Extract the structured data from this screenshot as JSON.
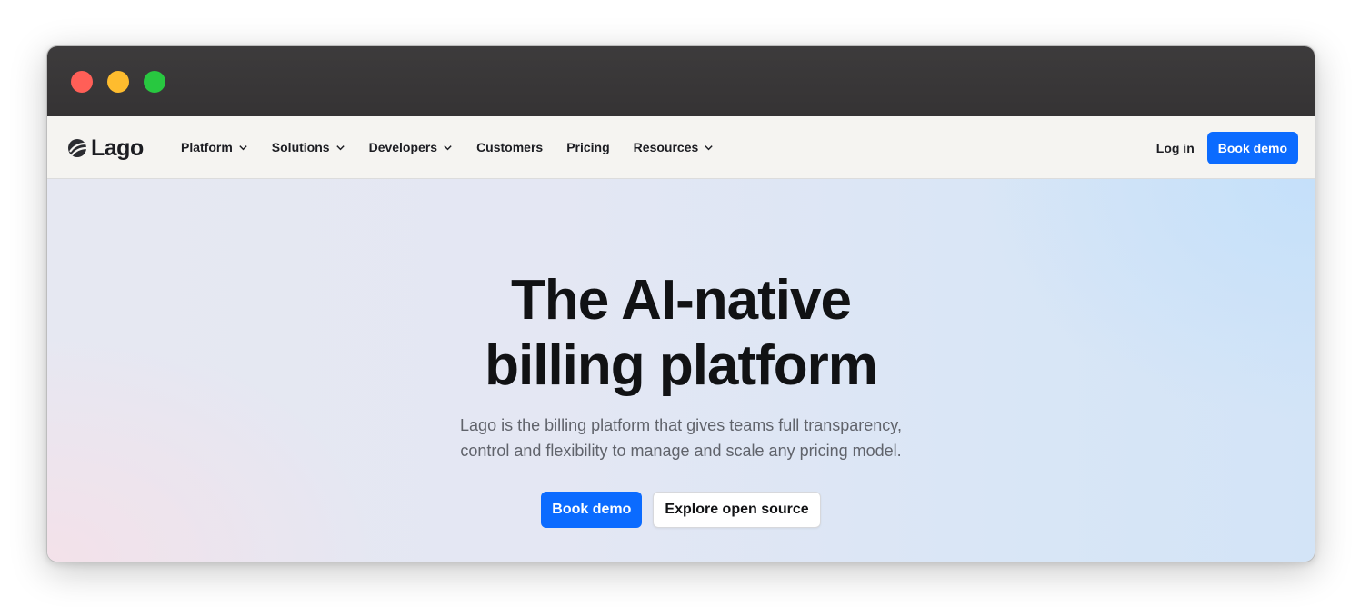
{
  "window": {
    "controls": [
      {
        "name": "close",
        "color": "#ff5f57"
      },
      {
        "name": "minimize",
        "color": "#febc2e"
      },
      {
        "name": "zoom",
        "color": "#28c840"
      }
    ]
  },
  "nav": {
    "logo_text": "Lago",
    "items": [
      {
        "label": "Platform",
        "dropdown": true
      },
      {
        "label": "Solutions",
        "dropdown": true
      },
      {
        "label": "Developers",
        "dropdown": true
      },
      {
        "label": "Customers",
        "dropdown": false
      },
      {
        "label": "Pricing",
        "dropdown": false
      },
      {
        "label": "Resources",
        "dropdown": true
      }
    ],
    "login_label": "Log in",
    "demo_label": "Book demo"
  },
  "hero": {
    "title_line1": "The AI-native",
    "title_line2": "billing platform",
    "subtitle_line1": "Lago is the billing platform that gives teams full transparency,",
    "subtitle_line2": "control and flexibility to manage and scale any pricing model.",
    "primary_cta": "Book demo",
    "secondary_cta": "Explore open source"
  },
  "colors": {
    "accent": "#0b6bff",
    "text": "#111214",
    "muted_text": "#60636b",
    "navbar_bg": "#f5f4f1",
    "titlebar_bg": "#3a3839"
  }
}
